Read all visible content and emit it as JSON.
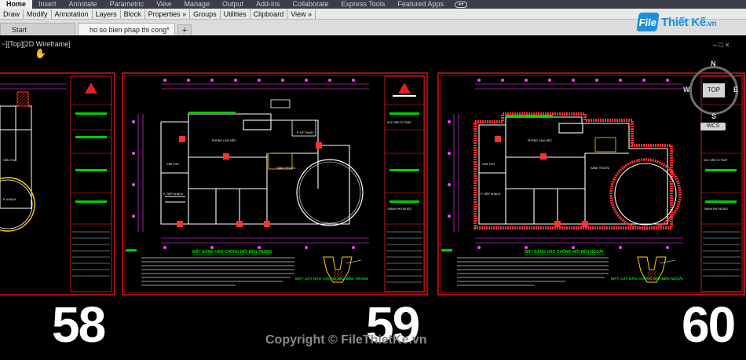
{
  "ribbon": {
    "tabs": [
      "Home",
      "Insert",
      "Annotate",
      "Parametric",
      "View",
      "Manage",
      "Output",
      "Add-ins",
      "Collaborate",
      "Express Tools",
      "Featured Apps"
    ],
    "active": "Home"
  },
  "panels": [
    "Draw",
    "Modify",
    "Annotation",
    "Layers",
    "Block",
    "Properties »",
    "Groups",
    "Utilities",
    "Clipboard",
    "View »"
  ],
  "file_tabs": {
    "start": "Start",
    "drawing": "ho so bien phap thi cong*",
    "close_glyph": "×",
    "add_glyph": "+"
  },
  "logo": {
    "mark": "File",
    "text": "Thiết Kế",
    "domain": ".vn"
  },
  "viewport": {
    "label": "−][Top][2D Wireframe]",
    "window_controls": "–  □  ×"
  },
  "viewcube": {
    "face": "TOP",
    "north": "N",
    "south": "S",
    "east": "E",
    "west": "W",
    "wcs": "WCS"
  },
  "sheets": [
    {
      "number": "58",
      "plan_labels": [
        "P. KHÁCH",
        "VĂN THƯ"
      ]
    },
    {
      "number": "59",
      "plan_title": "MẶT BẰNG HÀO CHỐNG MỐI BÊN TRONG",
      "section_title": "MẶT CẮT HÀO CHỐNG MỐI BÊN TRONG",
      "plan_labels": [
        "PHÒNG LÀM VIỆC",
        "VĂN THƯ",
        "P. TIẾP KHÁCH",
        "SẢNH TRƯỚC",
        "P. KỸ THUẬT"
      ],
      "title_block": [
        "HỌC VIỆN TƯ PHÁP",
        "THÀNH PHỐ HÀ NỘI"
      ]
    },
    {
      "number": "60",
      "plan_title": "MẶT BẰNG HÀO CHỐNG MỐI BÊN NGOÀI",
      "section_title": "MẶT CẮT HÀO CHỐNG MỐI BÊN NGOÀI",
      "plan_labels": [
        "PHÒNG LÀM VIỆC",
        "VĂN THƯ",
        "P. TIẾP KHÁCH",
        "SẢNH TRƯỚC"
      ],
      "title_block": [
        "HỌC VIỆN TƯ PHÁP",
        "THÀNH PHỐ HÀ NỘI"
      ]
    }
  ],
  "watermark": "Copyright © FileThietKe.vn",
  "colors": {
    "sheet_border": "#ff2020",
    "wall": "#ffffff",
    "dim": "#ff40ff",
    "green": "#00d000",
    "yellow": "#ffd000",
    "ribbon_bg": "#3b3f45"
  }
}
